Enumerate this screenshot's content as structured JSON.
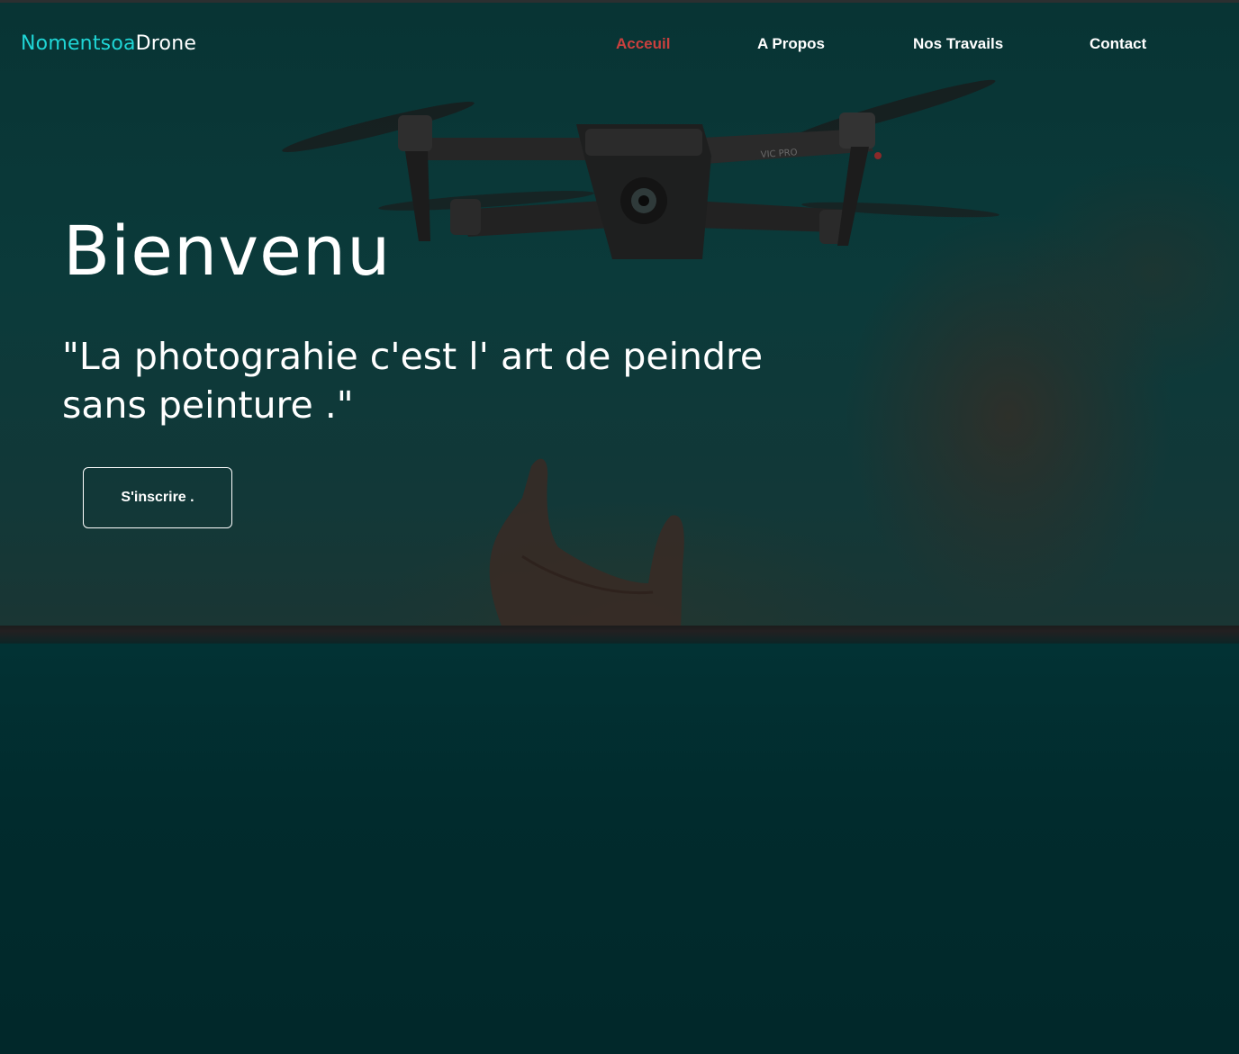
{
  "header": {
    "brand_part1": "Nomentsoa",
    "brand_part2": "Drone",
    "nav": [
      {
        "label": "Acceuil",
        "active": true
      },
      {
        "label": "A Propos",
        "active": false
      },
      {
        "label": "Nos Travails",
        "active": false
      },
      {
        "label": "Contact",
        "active": false
      }
    ]
  },
  "hero": {
    "title": "Bienvenu",
    "quote": "\"La photograhie c'est l' art de peindre sans peinture .\"",
    "cta_label": "S'inscrire .",
    "background_image": "drone-and-hand-photo",
    "drone_label": "VIC PRO"
  },
  "colors": {
    "brand_accent": "#1fd6d6",
    "active_link": "#c9403e",
    "background": "#012a2c"
  }
}
